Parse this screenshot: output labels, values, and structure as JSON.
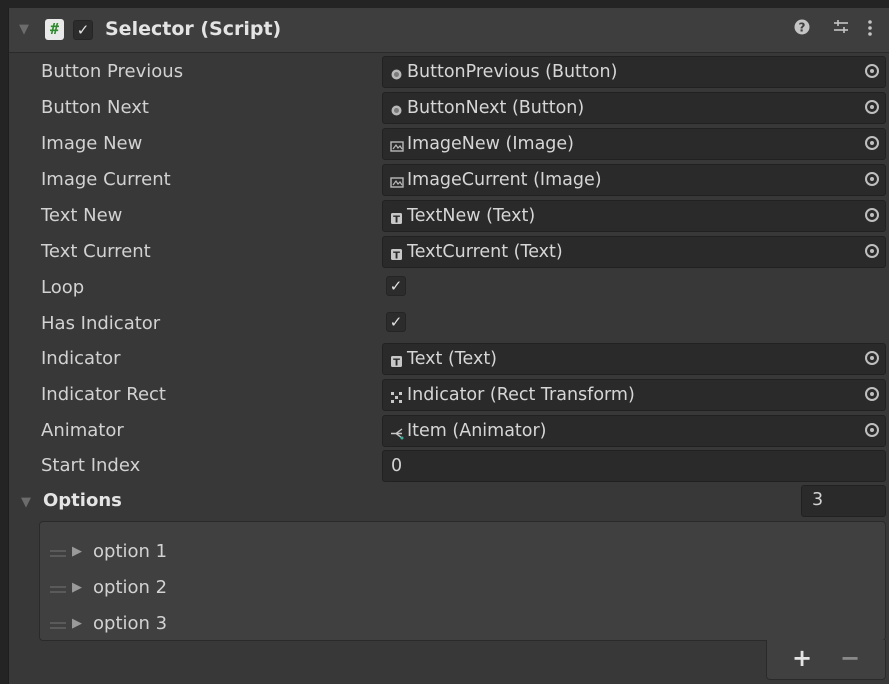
{
  "component": {
    "title": "Selector (Script)",
    "enabled": true,
    "icons": [
      "help-icon",
      "preset-icon",
      "kebab-menu-icon"
    ]
  },
  "fields": [
    {
      "label": "Button Previous",
      "value": "ButtonPrevious (Button)",
      "icon": "button-icon"
    },
    {
      "label": "Button Next",
      "value": "ButtonNext (Button)",
      "icon": "button-icon"
    },
    {
      "label": "Image New",
      "value": "ImageNew (Image)",
      "icon": "image-icon"
    },
    {
      "label": "Image Current",
      "value": "ImageCurrent (Image)",
      "icon": "image-icon"
    },
    {
      "label": "Text New",
      "value": "TextNew (Text)",
      "icon": "text-icon"
    },
    {
      "label": "Text Current",
      "value": "TextCurrent (Text)",
      "icon": "text-icon"
    }
  ],
  "loop": {
    "label": "Loop",
    "checked": true
  },
  "has_indicator": {
    "label": "Has Indicator",
    "checked": true
  },
  "indicator": {
    "label": "Indicator",
    "value": "Text (Text)",
    "icon": "text-icon"
  },
  "indicator_rect": {
    "label": "Indicator Rect",
    "value": "Indicator (Rect Transform)",
    "icon": "rect-transform-icon"
  },
  "animator": {
    "label": "Animator",
    "value": "Item (Animator)",
    "icon": "animator-icon"
  },
  "start_index": {
    "label": "Start Index",
    "value": "0"
  },
  "options": {
    "label": "Options",
    "size": "3",
    "items": [
      "option 1",
      "option 2",
      "option 3"
    ],
    "add_label": "+",
    "remove_label": "−"
  }
}
